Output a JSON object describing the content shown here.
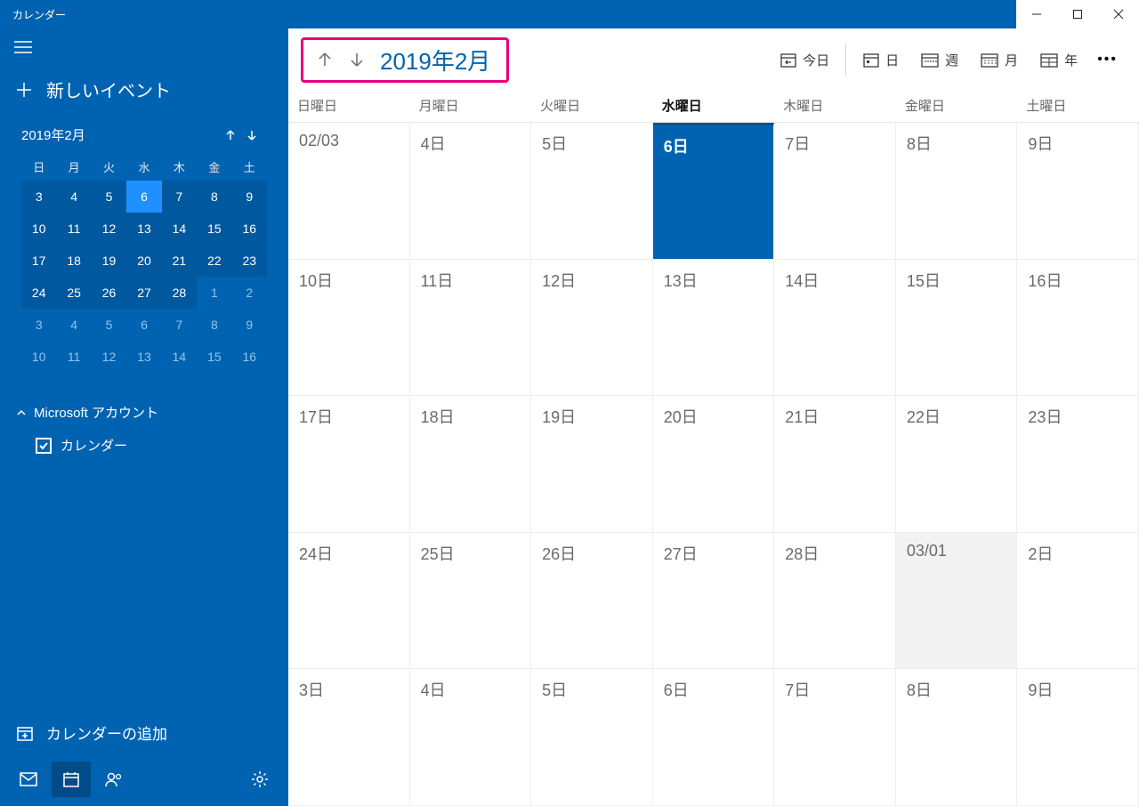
{
  "titlebar": {
    "title": "カレンダー"
  },
  "sidebar": {
    "new_event": "新しいイベント",
    "mini": {
      "title": "2019年2月",
      "dow": [
        "日",
        "月",
        "火",
        "水",
        "木",
        "金",
        "土"
      ],
      "days": [
        {
          "n": "3",
          "m": "cur"
        },
        {
          "n": "4",
          "m": "cur"
        },
        {
          "n": "5",
          "m": "cur"
        },
        {
          "n": "6",
          "m": "today"
        },
        {
          "n": "7",
          "m": "cur"
        },
        {
          "n": "8",
          "m": "cur"
        },
        {
          "n": "9",
          "m": "cur"
        },
        {
          "n": "10",
          "m": "cur"
        },
        {
          "n": "11",
          "m": "cur"
        },
        {
          "n": "12",
          "m": "cur"
        },
        {
          "n": "13",
          "m": "cur"
        },
        {
          "n": "14",
          "m": "cur"
        },
        {
          "n": "15",
          "m": "cur"
        },
        {
          "n": "16",
          "m": "cur"
        },
        {
          "n": "17",
          "m": "cur"
        },
        {
          "n": "18",
          "m": "cur"
        },
        {
          "n": "19",
          "m": "cur"
        },
        {
          "n": "20",
          "m": "cur"
        },
        {
          "n": "21",
          "m": "cur"
        },
        {
          "n": "22",
          "m": "cur"
        },
        {
          "n": "23",
          "m": "cur"
        },
        {
          "n": "24",
          "m": "cur"
        },
        {
          "n": "25",
          "m": "cur"
        },
        {
          "n": "26",
          "m": "cur"
        },
        {
          "n": "27",
          "m": "cur"
        },
        {
          "n": "28",
          "m": "cur"
        },
        {
          "n": "1",
          "m": "other"
        },
        {
          "n": "2",
          "m": "other"
        },
        {
          "n": "3",
          "m": "other"
        },
        {
          "n": "4",
          "m": "other"
        },
        {
          "n": "5",
          "m": "other"
        },
        {
          "n": "6",
          "m": "other"
        },
        {
          "n": "7",
          "m": "other"
        },
        {
          "n": "8",
          "m": "other"
        },
        {
          "n": "9",
          "m": "other"
        },
        {
          "n": "10",
          "m": "other"
        },
        {
          "n": "11",
          "m": "other"
        },
        {
          "n": "12",
          "m": "other"
        },
        {
          "n": "13",
          "m": "other"
        },
        {
          "n": "14",
          "m": "other"
        },
        {
          "n": "15",
          "m": "other"
        },
        {
          "n": "16",
          "m": "other"
        }
      ]
    },
    "account_label": "Microsoft アカウント",
    "calendar_item": "カレンダー",
    "add_calendar": "カレンダーの追加"
  },
  "toolbar": {
    "title": "2019年2月",
    "today": "今日",
    "views": {
      "day": "日",
      "week": "週",
      "month": "月",
      "year": "年"
    }
  },
  "weekdays": [
    {
      "label": "日曜日",
      "today": false
    },
    {
      "label": "月曜日",
      "today": false
    },
    {
      "label": "火曜日",
      "today": false
    },
    {
      "label": "水曜日",
      "today": true
    },
    {
      "label": "木曜日",
      "today": false
    },
    {
      "label": "金曜日",
      "today": false
    },
    {
      "label": "土曜日",
      "today": false
    }
  ],
  "month_cells": [
    {
      "t": "02/03",
      "c": ""
    },
    {
      "t": "4日",
      "c": ""
    },
    {
      "t": "5日",
      "c": ""
    },
    {
      "t": "6日",
      "c": "today"
    },
    {
      "t": "7日",
      "c": ""
    },
    {
      "t": "8日",
      "c": ""
    },
    {
      "t": "9日",
      "c": ""
    },
    {
      "t": "10日",
      "c": ""
    },
    {
      "t": "11日",
      "c": ""
    },
    {
      "t": "12日",
      "c": ""
    },
    {
      "t": "13日",
      "c": ""
    },
    {
      "t": "14日",
      "c": ""
    },
    {
      "t": "15日",
      "c": ""
    },
    {
      "t": "16日",
      "c": ""
    },
    {
      "t": "17日",
      "c": ""
    },
    {
      "t": "18日",
      "c": ""
    },
    {
      "t": "19日",
      "c": ""
    },
    {
      "t": "20日",
      "c": ""
    },
    {
      "t": "21日",
      "c": ""
    },
    {
      "t": "22日",
      "c": ""
    },
    {
      "t": "23日",
      "c": ""
    },
    {
      "t": "24日",
      "c": ""
    },
    {
      "t": "25日",
      "c": ""
    },
    {
      "t": "26日",
      "c": ""
    },
    {
      "t": "27日",
      "c": ""
    },
    {
      "t": "28日",
      "c": ""
    },
    {
      "t": "03/01",
      "c": "nextmonth-first"
    },
    {
      "t": "2日",
      "c": ""
    },
    {
      "t": "3日",
      "c": ""
    },
    {
      "t": "4日",
      "c": ""
    },
    {
      "t": "5日",
      "c": ""
    },
    {
      "t": "6日",
      "c": ""
    },
    {
      "t": "7日",
      "c": ""
    },
    {
      "t": "8日",
      "c": ""
    },
    {
      "t": "9日",
      "c": ""
    }
  ]
}
